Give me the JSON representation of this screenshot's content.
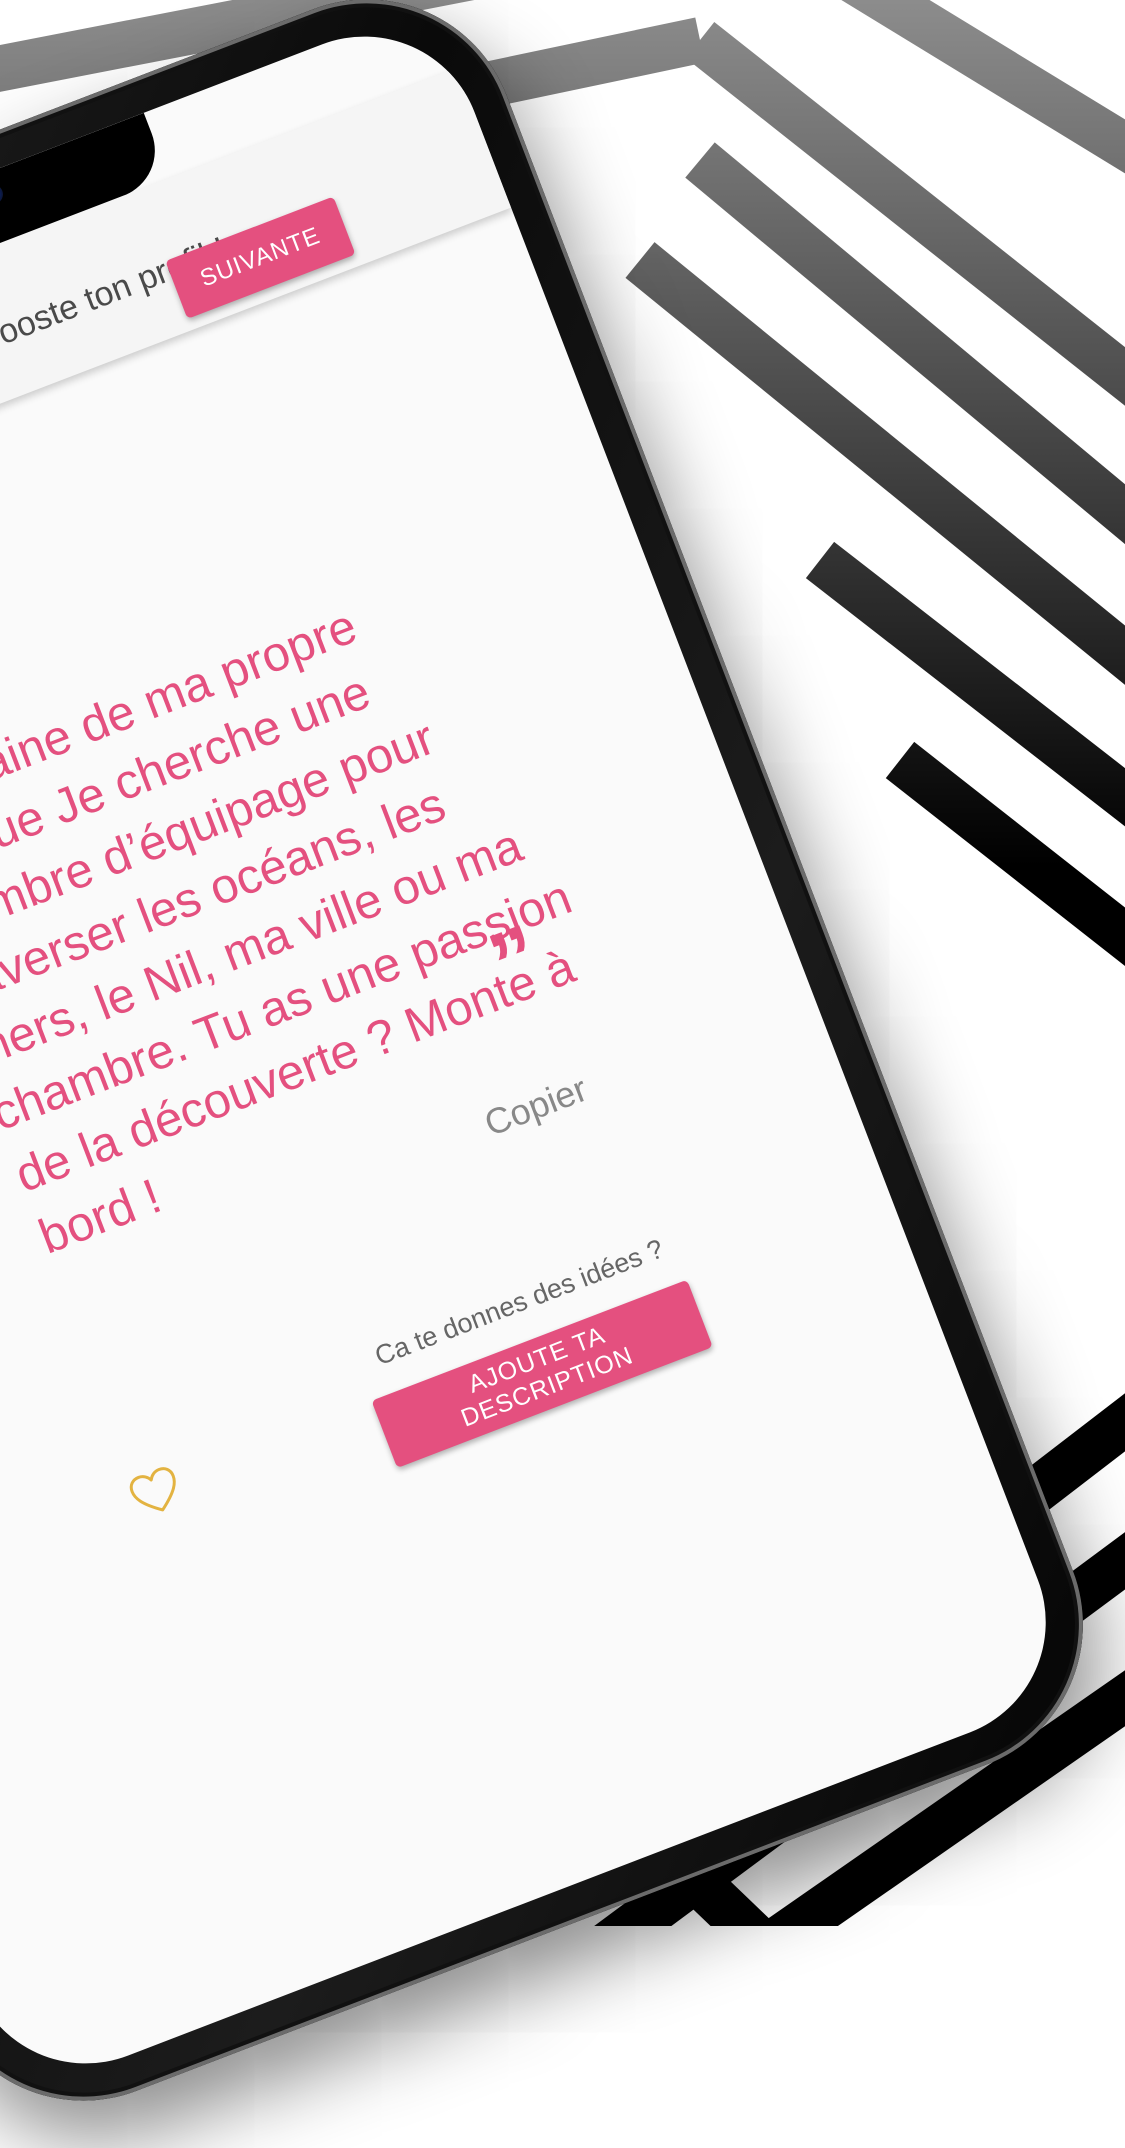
{
  "app": {
    "title": "MeetSumUp: booste ton profil !",
    "next_label": "SUIVANTE"
  },
  "quote": {
    "open_mark": "“",
    "text": "Capitaine de ma propre barque Je cherche une membre d’équipage pour traverser les océans, les mers, le Nil, ma ville ou ma chambre. Tu as une passion de la découverte ? Monte à bord !",
    "close_mark": "”",
    "copy_label": "Copier"
  },
  "footer": {
    "question": "Ca te donnes des idées ?",
    "add_description_label": "AJOUTE TA DESCRIPTION"
  },
  "icons": {
    "menu": "hamburger-menu-icon",
    "favorite": "heart-outline-icon"
  },
  "colors": {
    "accent": "#e4507f",
    "heart": "#e3b341"
  }
}
